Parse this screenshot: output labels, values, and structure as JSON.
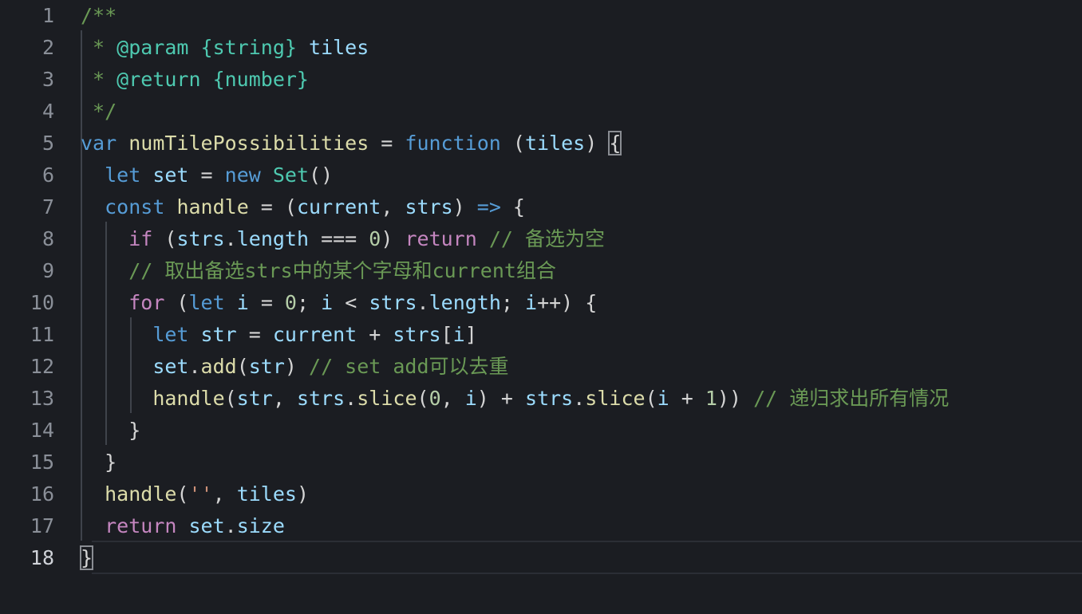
{
  "editor": {
    "language": "javascript",
    "active_line": 18,
    "line_numbers": [
      "1",
      "2",
      "3",
      "4",
      "5",
      "6",
      "7",
      "8",
      "9",
      "10",
      "11",
      "12",
      "13",
      "14",
      "15",
      "16",
      "17",
      "18"
    ],
    "lines": [
      {
        "tokens": [
          {
            "t": "/**",
            "c": "cm"
          }
        ]
      },
      {
        "tokens": [
          {
            "t": " * ",
            "c": "cm"
          },
          {
            "t": "@param",
            "c": "cm-tag"
          },
          {
            "t": " ",
            "c": "cm"
          },
          {
            "t": "{string}",
            "c": "cm-tag"
          },
          {
            "t": " ",
            "c": "cm"
          },
          {
            "t": "tiles",
            "c": "var"
          }
        ]
      },
      {
        "tokens": [
          {
            "t": " * ",
            "c": "cm"
          },
          {
            "t": "@return",
            "c": "cm-tag"
          },
          {
            "t": " ",
            "c": "cm"
          },
          {
            "t": "{number}",
            "c": "cm-tag"
          }
        ]
      },
      {
        "tokens": [
          {
            "t": " */",
            "c": "cm"
          }
        ]
      },
      {
        "tokens": [
          {
            "t": "var",
            "c": "kw"
          },
          {
            "t": " ",
            "c": "op"
          },
          {
            "t": "numTilePossibilities",
            "c": "fn"
          },
          {
            "t": " = ",
            "c": "op"
          },
          {
            "t": "function",
            "c": "kw"
          },
          {
            "t": " (",
            "c": "pun"
          },
          {
            "t": "tiles",
            "c": "var"
          },
          {
            "t": ") ",
            "c": "pun"
          },
          {
            "t": "{",
            "c": "pun",
            "match": true
          }
        ]
      },
      {
        "tokens": [
          {
            "t": "  ",
            "c": "op"
          },
          {
            "t": "let",
            "c": "kw"
          },
          {
            "t": " ",
            "c": "op"
          },
          {
            "t": "set",
            "c": "var"
          },
          {
            "t": " = ",
            "c": "op"
          },
          {
            "t": "new",
            "c": "kw"
          },
          {
            "t": " ",
            "c": "op"
          },
          {
            "t": "Set",
            "c": "cls"
          },
          {
            "t": "()",
            "c": "pun"
          }
        ]
      },
      {
        "tokens": [
          {
            "t": "  ",
            "c": "op"
          },
          {
            "t": "const",
            "c": "kw"
          },
          {
            "t": " ",
            "c": "op"
          },
          {
            "t": "handle",
            "c": "fn"
          },
          {
            "t": " = (",
            "c": "op"
          },
          {
            "t": "current",
            "c": "var"
          },
          {
            "t": ", ",
            "c": "pun"
          },
          {
            "t": "strs",
            "c": "var"
          },
          {
            "t": ") ",
            "c": "pun"
          },
          {
            "t": "=>",
            "c": "kw"
          },
          {
            "t": " {",
            "c": "pun"
          }
        ]
      },
      {
        "tokens": [
          {
            "t": "    ",
            "c": "op"
          },
          {
            "t": "if",
            "c": "ctl"
          },
          {
            "t": " (",
            "c": "pun"
          },
          {
            "t": "strs",
            "c": "var"
          },
          {
            "t": ".",
            "c": "pun"
          },
          {
            "t": "length",
            "c": "var"
          },
          {
            "t": " === ",
            "c": "op"
          },
          {
            "t": "0",
            "c": "num"
          },
          {
            "t": ") ",
            "c": "pun"
          },
          {
            "t": "return",
            "c": "ctl"
          },
          {
            "t": " // 备选为空",
            "c": "cm"
          }
        ]
      },
      {
        "tokens": [
          {
            "t": "    ",
            "c": "op"
          },
          {
            "t": "// 取出备选strs中的某个字母和current组合",
            "c": "cm"
          }
        ]
      },
      {
        "tokens": [
          {
            "t": "    ",
            "c": "op"
          },
          {
            "t": "for",
            "c": "ctl"
          },
          {
            "t": " (",
            "c": "pun"
          },
          {
            "t": "let",
            "c": "kw"
          },
          {
            "t": " ",
            "c": "op"
          },
          {
            "t": "i",
            "c": "var"
          },
          {
            "t": " = ",
            "c": "op"
          },
          {
            "t": "0",
            "c": "num"
          },
          {
            "t": "; ",
            "c": "pun"
          },
          {
            "t": "i",
            "c": "var"
          },
          {
            "t": " < ",
            "c": "op"
          },
          {
            "t": "strs",
            "c": "var"
          },
          {
            "t": ".",
            "c": "pun"
          },
          {
            "t": "length",
            "c": "var"
          },
          {
            "t": "; ",
            "c": "pun"
          },
          {
            "t": "i",
            "c": "var"
          },
          {
            "t": "++) {",
            "c": "pun"
          }
        ]
      },
      {
        "tokens": [
          {
            "t": "      ",
            "c": "op"
          },
          {
            "t": "let",
            "c": "kw"
          },
          {
            "t": " ",
            "c": "op"
          },
          {
            "t": "str",
            "c": "var"
          },
          {
            "t": " = ",
            "c": "op"
          },
          {
            "t": "current",
            "c": "var"
          },
          {
            "t": " + ",
            "c": "op"
          },
          {
            "t": "strs",
            "c": "var"
          },
          {
            "t": "[",
            "c": "pun"
          },
          {
            "t": "i",
            "c": "var"
          },
          {
            "t": "]",
            "c": "pun"
          }
        ]
      },
      {
        "tokens": [
          {
            "t": "      ",
            "c": "op"
          },
          {
            "t": "set",
            "c": "var"
          },
          {
            "t": ".",
            "c": "pun"
          },
          {
            "t": "add",
            "c": "fn"
          },
          {
            "t": "(",
            "c": "pun"
          },
          {
            "t": "str",
            "c": "var"
          },
          {
            "t": ") ",
            "c": "pun"
          },
          {
            "t": "// set add可以去重",
            "c": "cm"
          }
        ]
      },
      {
        "tokens": [
          {
            "t": "      ",
            "c": "op"
          },
          {
            "t": "handle",
            "c": "fn"
          },
          {
            "t": "(",
            "c": "pun"
          },
          {
            "t": "str",
            "c": "var"
          },
          {
            "t": ", ",
            "c": "pun"
          },
          {
            "t": "strs",
            "c": "var"
          },
          {
            "t": ".",
            "c": "pun"
          },
          {
            "t": "slice",
            "c": "fn"
          },
          {
            "t": "(",
            "c": "pun"
          },
          {
            "t": "0",
            "c": "num"
          },
          {
            "t": ", ",
            "c": "pun"
          },
          {
            "t": "i",
            "c": "var"
          },
          {
            "t": ") + ",
            "c": "op"
          },
          {
            "t": "strs",
            "c": "var"
          },
          {
            "t": ".",
            "c": "pun"
          },
          {
            "t": "slice",
            "c": "fn"
          },
          {
            "t": "(",
            "c": "pun"
          },
          {
            "t": "i",
            "c": "var"
          },
          {
            "t": " + ",
            "c": "op"
          },
          {
            "t": "1",
            "c": "num"
          },
          {
            "t": ")) ",
            "c": "pun"
          },
          {
            "t": "// 递归求出所有情况",
            "c": "cm"
          }
        ]
      },
      {
        "tokens": [
          {
            "t": "    }",
            "c": "pun"
          }
        ]
      },
      {
        "tokens": [
          {
            "t": "  }",
            "c": "pun"
          }
        ]
      },
      {
        "tokens": [
          {
            "t": "  ",
            "c": "op"
          },
          {
            "t": "handle",
            "c": "fn"
          },
          {
            "t": "(",
            "c": "pun"
          },
          {
            "t": "''",
            "c": "str"
          },
          {
            "t": ", ",
            "c": "pun"
          },
          {
            "t": "tiles",
            "c": "var"
          },
          {
            "t": ")",
            "c": "pun"
          }
        ]
      },
      {
        "tokens": [
          {
            "t": "  ",
            "c": "op"
          },
          {
            "t": "return",
            "c": "ctl"
          },
          {
            "t": " ",
            "c": "op"
          },
          {
            "t": "set",
            "c": "var"
          },
          {
            "t": ".",
            "c": "pun"
          },
          {
            "t": "size",
            "c": "var"
          }
        ]
      },
      {
        "tokens": [
          {
            "t": "}",
            "c": "pun",
            "match": true
          }
        ]
      }
    ]
  },
  "colors": {
    "background": "#1b1d22",
    "comment": "#6a9955",
    "keyword": "#569cd6",
    "control": "#c586c0",
    "function": "#dcdcaa",
    "variable": "#9cdcfe",
    "number": "#b5cea8",
    "string": "#ce9178"
  }
}
